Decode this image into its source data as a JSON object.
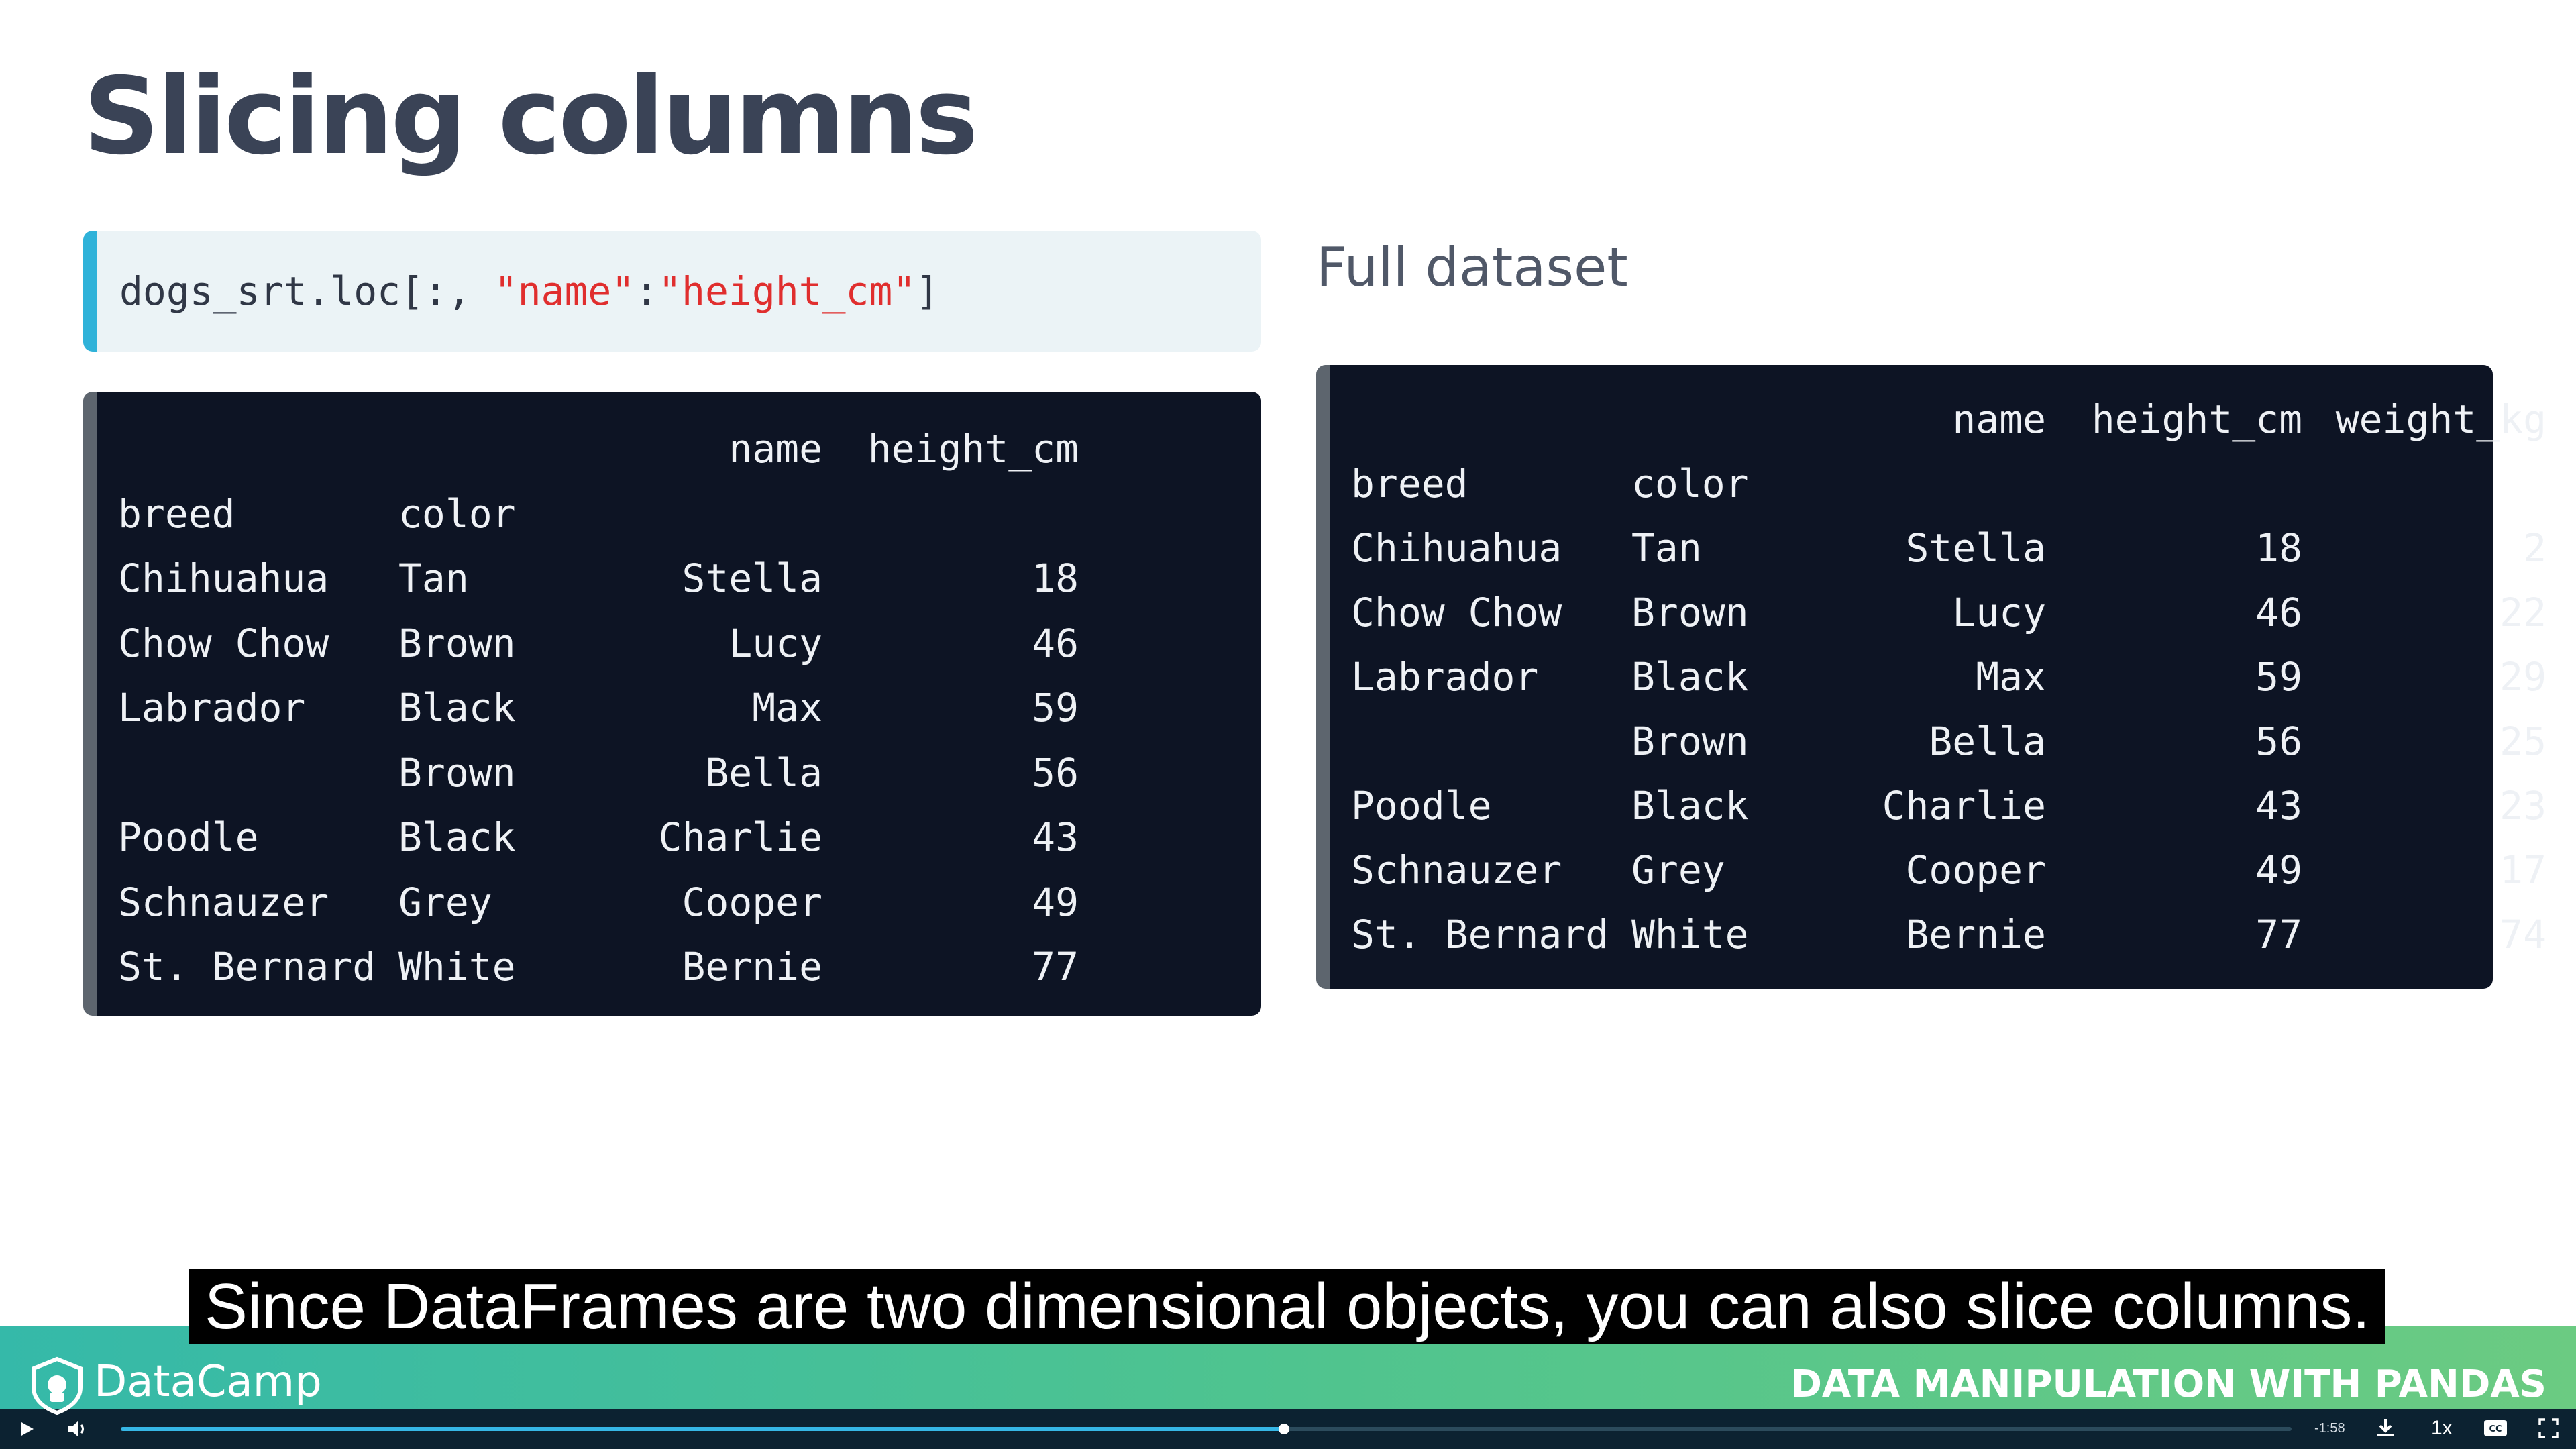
{
  "slide": {
    "title": "Slicing columns",
    "code": {
      "prefix": "dogs_srt.loc[:, ",
      "str1": "\"name\"",
      "colon": ":",
      "str2": "\"height_cm\"",
      "suffix": "]"
    },
    "full_dataset_label": "Full dataset"
  },
  "left_table": {
    "columns": [
      "name",
      "height_cm"
    ],
    "index_names": [
      "breed",
      "color"
    ],
    "rows": [
      {
        "breed": "Chihuahua",
        "color": "Tan",
        "name": "Stella",
        "height_cm": "18"
      },
      {
        "breed": "Chow Chow",
        "color": "Brown",
        "name": "Lucy",
        "height_cm": "46"
      },
      {
        "breed": "Labrador",
        "color": "Black",
        "name": "Max",
        "height_cm": "59"
      },
      {
        "breed": "",
        "color": "Brown",
        "name": "Bella",
        "height_cm": "56"
      },
      {
        "breed": "Poodle",
        "color": "Black",
        "name": "Charlie",
        "height_cm": "43"
      },
      {
        "breed": "Schnauzer",
        "color": "Grey",
        "name": "Cooper",
        "height_cm": "49"
      },
      {
        "breed": "St. Bernard",
        "color": "White",
        "name": "Bernie",
        "height_cm": "77"
      }
    ]
  },
  "right_table": {
    "columns": [
      "name",
      "height_cm",
      "weight_kg"
    ],
    "index_names": [
      "breed",
      "color"
    ],
    "rows": [
      {
        "breed": "Chihuahua",
        "color": "Tan",
        "name": "Stella",
        "height_cm": "18",
        "weight_kg": "2"
      },
      {
        "breed": "Chow Chow",
        "color": "Brown",
        "name": "Lucy",
        "height_cm": "46",
        "weight_kg": "22"
      },
      {
        "breed": "Labrador",
        "color": "Black",
        "name": "Max",
        "height_cm": "59",
        "weight_kg": "29"
      },
      {
        "breed": "",
        "color": "Brown",
        "name": "Bella",
        "height_cm": "56",
        "weight_kg": "25"
      },
      {
        "breed": "Poodle",
        "color": "Black",
        "name": "Charlie",
        "height_cm": "43",
        "weight_kg": "23"
      },
      {
        "breed": "Schnauzer",
        "color": "Grey",
        "name": "Cooper",
        "height_cm": "49",
        "weight_kg": "17"
      },
      {
        "breed": "St. Bernard",
        "color": "White",
        "name": "Bernie",
        "height_cm": "77",
        "weight_kg": "74"
      }
    ]
  },
  "caption": "Since DataFrames are two dimensional objects, you can also slice columns.",
  "footer": {
    "brand": "DataCamp",
    "brand_icon": "datacamp-logo-icon",
    "course_title": "DATA MANIPULATION WITH PANDAS"
  },
  "player": {
    "time_remaining": "-1:58",
    "speed": "1x",
    "progress": 0.536,
    "icons": [
      "play-icon",
      "volume-icon",
      "download-icon",
      "captions-icon",
      "fullscreen-icon"
    ],
    "accent": "#36b7e6"
  },
  "colors": {
    "title": "#3a4356",
    "code_accent": "#2fb2d9",
    "code_string": "#e02e2e",
    "table_bg": "#0d1424"
  }
}
